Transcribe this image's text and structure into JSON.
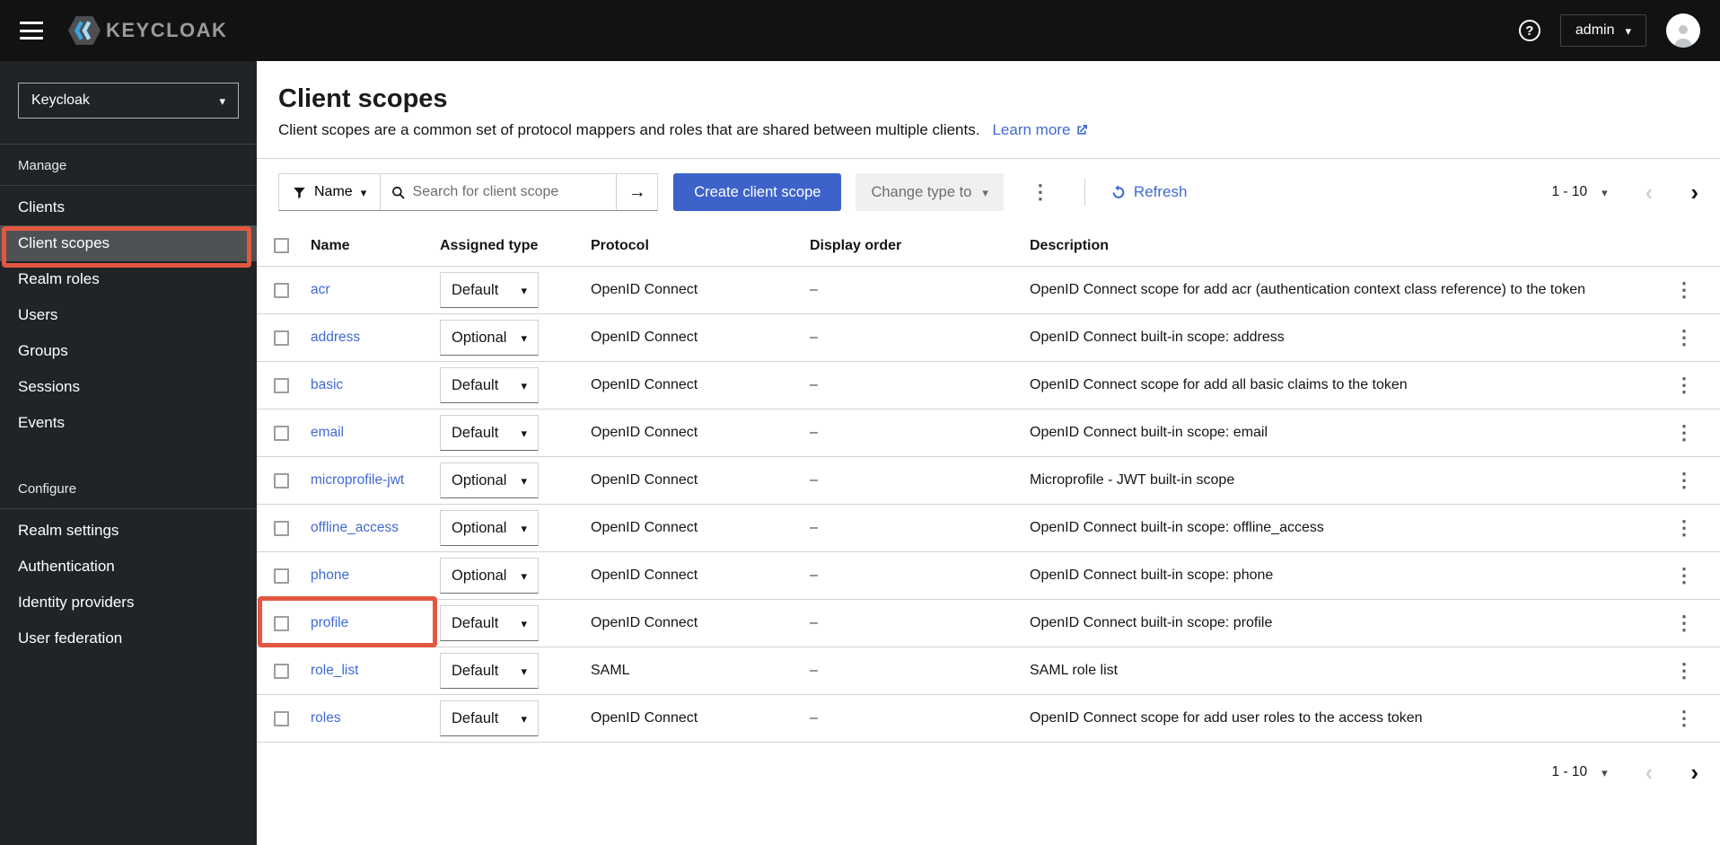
{
  "masthead": {
    "brand": "KEYCLOAK",
    "user": "admin"
  },
  "sidebar": {
    "realm_selector": "Keycloak",
    "groups": [
      {
        "label": "Manage",
        "items": [
          {
            "label": "Clients",
            "active": false
          },
          {
            "label": "Client scopes",
            "active": true
          },
          {
            "label": "Realm roles",
            "active": false
          },
          {
            "label": "Users",
            "active": false
          },
          {
            "label": "Groups",
            "active": false
          },
          {
            "label": "Sessions",
            "active": false
          },
          {
            "label": "Events",
            "active": false
          }
        ]
      },
      {
        "label": "Configure",
        "items": [
          {
            "label": "Realm settings",
            "active": false
          },
          {
            "label": "Authentication",
            "active": false
          },
          {
            "label": "Identity providers",
            "active": false
          },
          {
            "label": "User federation",
            "active": false
          }
        ]
      }
    ]
  },
  "page": {
    "title": "Client scopes",
    "description": "Client scopes are a common set of protocol mappers and roles that are shared between multiple clients.",
    "learn_more_label": "Learn more"
  },
  "toolbar": {
    "filter_label": "Name",
    "search_placeholder": "Search for client scope",
    "create_button_label": "Create client scope",
    "change_type_button_label": "Change type to",
    "refresh_label": "Refresh",
    "pagination_range": "1 - 10"
  },
  "table": {
    "columns": [
      "Name",
      "Assigned type",
      "Protocol",
      "Display order",
      "Description"
    ],
    "rows": [
      {
        "name": "acr",
        "assigned_type": "Default",
        "protocol": "OpenID Connect",
        "display_order": "–",
        "description": "OpenID Connect scope for add acr (authentication context class reference) to the token",
        "highlighted": false
      },
      {
        "name": "address",
        "assigned_type": "Optional",
        "protocol": "OpenID Connect",
        "display_order": "–",
        "description": "OpenID Connect built-in scope: address",
        "highlighted": false
      },
      {
        "name": "basic",
        "assigned_type": "Default",
        "protocol": "OpenID Connect",
        "display_order": "–",
        "description": "OpenID Connect scope for add all basic claims to the token",
        "highlighted": false
      },
      {
        "name": "email",
        "assigned_type": "Default",
        "protocol": "OpenID Connect",
        "display_order": "–",
        "description": "OpenID Connect built-in scope: email",
        "highlighted": false
      },
      {
        "name": "microprofile-jwt",
        "assigned_type": "Optional",
        "protocol": "OpenID Connect",
        "display_order": "–",
        "description": "Microprofile - JWT built-in scope",
        "highlighted": false
      },
      {
        "name": "offline_access",
        "assigned_type": "Optional",
        "protocol": "OpenID Connect",
        "display_order": "–",
        "description": "OpenID Connect built-in scope: offline_access",
        "highlighted": false
      },
      {
        "name": "phone",
        "assigned_type": "Optional",
        "protocol": "OpenID Connect",
        "display_order": "–",
        "description": "OpenID Connect built-in scope: phone",
        "highlighted": false
      },
      {
        "name": "profile",
        "assigned_type": "Default",
        "protocol": "OpenID Connect",
        "display_order": "–",
        "description": "OpenID Connect built-in scope: profile",
        "highlighted": true
      },
      {
        "name": "role_list",
        "assigned_type": "Default",
        "protocol": "SAML",
        "display_order": "–",
        "description": "SAML role list",
        "highlighted": false
      },
      {
        "name": "roles",
        "assigned_type": "Default",
        "protocol": "OpenID Connect",
        "display_order": "–",
        "description": "OpenID Connect scope for add user roles to the access token",
        "highlighted": false
      }
    ]
  },
  "bottom_pagination_range": "1 - 10",
  "icons": {
    "kebab": "⋮",
    "caret_down": "▾",
    "arrow_right": "→",
    "chevron_left": "‹",
    "chevron_right": "›",
    "help": "?"
  },
  "colors": {
    "primary_button_blue": "#3d62c9",
    "link_blue": "#4169d2",
    "annotation_red": "#e25740",
    "masthead_bg": "#121212",
    "sidebar_bg": "#212427"
  }
}
